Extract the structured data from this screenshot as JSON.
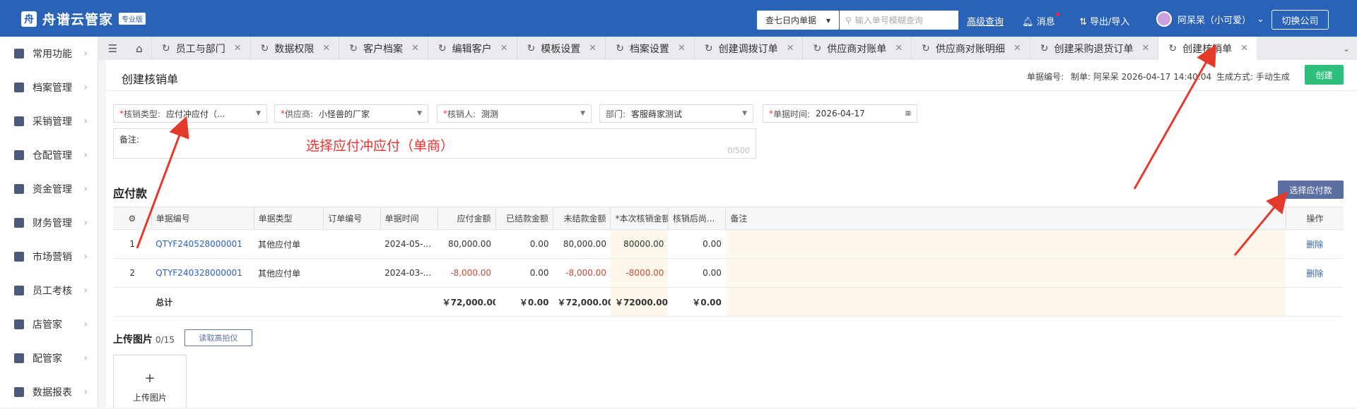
{
  "topbar": {
    "brand_logo": "舟",
    "brand_name": "舟谱云管家",
    "brand_badge": "专业版",
    "scope_select": "查七日内单据",
    "search_placeholder": "输入单号模糊查询",
    "advanced_query": "高级查询",
    "messages": "消息",
    "export_import": "导出/导入",
    "user_name": "阿呆呆（小可爱）",
    "switch_company": "切换公司"
  },
  "sidebar": {
    "items": [
      {
        "label": "常用功能"
      },
      {
        "label": "档案管理"
      },
      {
        "label": "采销管理"
      },
      {
        "label": "仓配管理"
      },
      {
        "label": "资金管理"
      },
      {
        "label": "财务管理"
      },
      {
        "label": "市场营销"
      },
      {
        "label": "员工考核"
      },
      {
        "label": "店管家"
      },
      {
        "label": "配管家"
      },
      {
        "label": "数据报表"
      }
    ]
  },
  "tabs": [
    {
      "label": "员工与部门"
    },
    {
      "label": "数据权限"
    },
    {
      "label": "客户档案"
    },
    {
      "label": "编辑客户"
    },
    {
      "label": "模板设置"
    },
    {
      "label": "档案设置"
    },
    {
      "label": "创建调拨订单"
    },
    {
      "label": "供应商对账单"
    },
    {
      "label": "供应商对账明细"
    },
    {
      "label": "创建采购退货订单"
    },
    {
      "label": "创建核销单"
    }
  ],
  "page": {
    "title": "创建核销单",
    "doc_no_label": "单据编号:",
    "creator": "制单: 阿呆呆 2026-04-17 14:40:04",
    "gen_method": "生成方式: 手动生成",
    "create_button": "创建"
  },
  "form": {
    "write_off_type_label": "核销类型:",
    "write_off_type_value": "应付冲应付（...",
    "supplier_label": "供应商:",
    "supplier_value": "小怪兽的厂家",
    "operator_label": "核销人:",
    "operator_value": "测测",
    "dept_label": "部门:",
    "dept_value": "客服蒔家测试",
    "date_label": "单据时间:",
    "date_value": "2026-04-17",
    "remarks_label": "备注:",
    "remarks_count": "0/500",
    "annotation": "选择应付冲应付（单商）"
  },
  "payables": {
    "title": "应付款",
    "select_button": "选择应付款",
    "columns": [
      "单据编号",
      "单据类型",
      "订单编号",
      "单据时间",
      "应付金额",
      "已结款金额",
      "未结款金额",
      "*本次核销金额",
      "核销后尚...",
      "备注",
      "操作"
    ],
    "rows": [
      {
        "idx": "1",
        "doc_no": "QTYF240528000001",
        "type": "其他应付单",
        "order_no": "",
        "time": "2024-05-...",
        "payable": "80,000.00",
        "settled": "0.00",
        "unsettled": "80,000.00",
        "current": "80000.00",
        "remaining": "0.00",
        "remark": "",
        "action": "删除"
      },
      {
        "idx": "2",
        "doc_no": "QTYF240328000001",
        "type": "其他应付单",
        "order_no": "",
        "time": "2024-03-...",
        "payable": "-8,000.00",
        "settled": "0.00",
        "unsettled": "-8,000.00",
        "current": "-8000.00",
        "remaining": "0.00",
        "remark": "",
        "action": "删除"
      }
    ],
    "total": {
      "label": "总计",
      "payable": "￥72,000.00",
      "settled": "￥0.00",
      "unsettled": "￥72,000.00",
      "current": "￥72000.00",
      "remaining": "￥0.00"
    }
  },
  "upload": {
    "title": "上传图片",
    "count": "0/15",
    "read_button": "读取高拍仪",
    "box_label": "上传图片",
    "plus": "+"
  },
  "colors": {
    "brand": "#2a62b8",
    "create": "#2fbf7d",
    "annotation": "#e33a2a",
    "select_button": "#5d6ea0"
  }
}
